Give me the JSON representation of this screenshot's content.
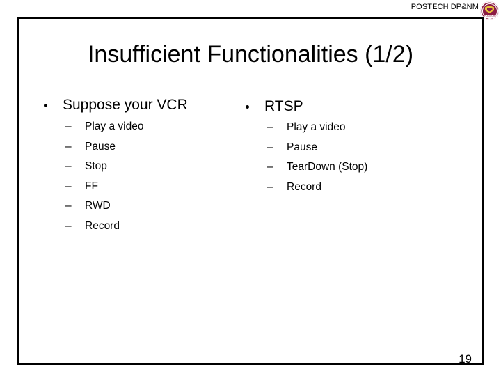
{
  "header": {
    "title": "POSTECH DP&NM",
    "logo_name": "postech-seal-logo",
    "logo_caption": "POSTECH",
    "accent_color": "#8c1b43"
  },
  "slide": {
    "title": "Insufficient Functionalities (1/2)",
    "page_number": "19",
    "columns": [
      {
        "heading": "Suppose your VCR",
        "items": [
          "Play a video",
          "Pause",
          "Stop",
          "FF",
          "RWD",
          "Record"
        ]
      },
      {
        "heading": "RTSP",
        "items": [
          "Play a video",
          "Pause",
          "TearDown (Stop)",
          "Record"
        ]
      }
    ],
    "bullet_glyph": "•",
    "dash_glyph": "–"
  }
}
